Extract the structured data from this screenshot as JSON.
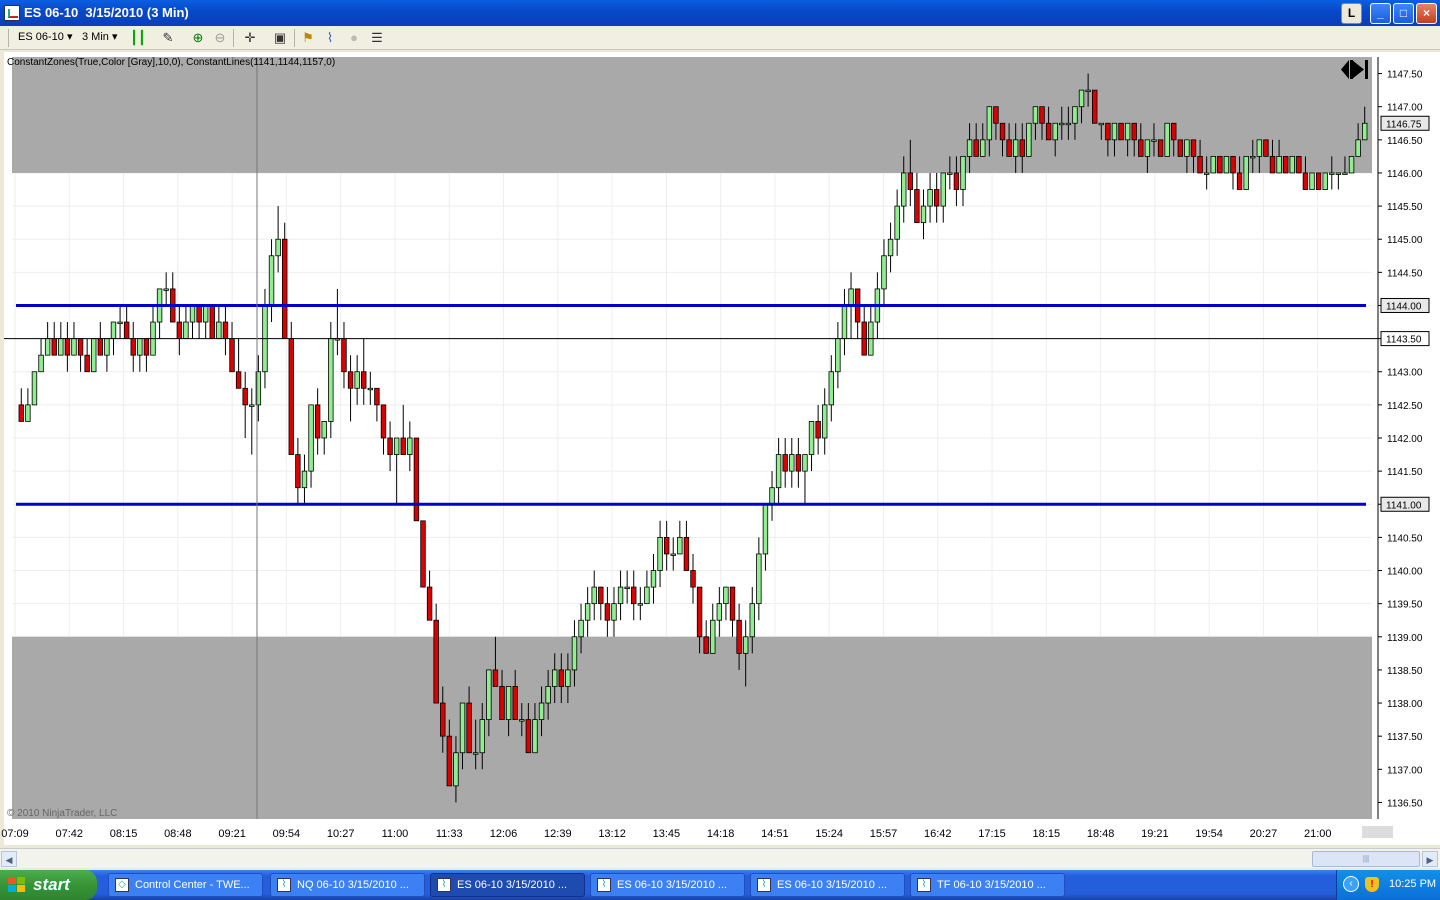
{
  "window": {
    "title": "ES 06-10  3/15/2010 (3 Min)",
    "buttons": {
      "restore_small": "L",
      "minimize": "_",
      "maximize": "□",
      "close": "×"
    }
  },
  "toolbar": {
    "instrument": "ES 06-10",
    "interval": "3 Min",
    "icons": [
      "bar-style-icon",
      "drawing-tool-icon",
      "zoom-in-icon",
      "zoom-out-icon",
      "crosshair-icon",
      "properties-icon",
      "strategies-icon",
      "indicators-icon",
      "record-icon",
      "data-box-icon"
    ]
  },
  "chart": {
    "indicator_label": "ConstantZones(True,Color [Gray],10,0), ConstantLines(1141,1144,1157,0)",
    "copyright": "© 2010 NinjaTrader, LLC",
    "last_price_label": "1146.75",
    "crosshair_price_label": "1143.50",
    "jump_to_end_icon": "jump-to-end-icon"
  },
  "chart_data": {
    "type": "candlestick",
    "y_range": [
      1136.25,
      1147.75
    ],
    "y_ticks": [
      "1147.50",
      "1147.00",
      "1146.50",
      "1146.00",
      "1145.50",
      "1145.00",
      "1144.50",
      "1144.00",
      "1143.50",
      "1143.00",
      "1142.50",
      "1142.00",
      "1141.50",
      "1141.00",
      "1140.50",
      "1140.00",
      "1139.50",
      "1139.00",
      "1138.50",
      "1138.00",
      "1137.50",
      "1137.00",
      "1136.50"
    ],
    "y_tick_values": [
      1147.5,
      1147.0,
      1146.5,
      1146.0,
      1145.5,
      1145.0,
      1144.5,
      1144.0,
      1143.5,
      1143.0,
      1142.5,
      1142.0,
      1141.5,
      1141.0,
      1140.5,
      1140.0,
      1139.5,
      1139.0,
      1138.5,
      1138.0,
      1137.5,
      1137.0,
      1136.5
    ],
    "x_ticks": [
      "07:09",
      "07:42",
      "08:15",
      "08:48",
      "09:21",
      "09:54",
      "10:27",
      "11:00",
      "11:33",
      "12:06",
      "12:39",
      "13:12",
      "13:45",
      "14:18",
      "14:51",
      "15:24",
      "15:57",
      "16:42",
      "17:15",
      "18:15",
      "18:48",
      "19:21",
      "19:54",
      "20:27",
      "21:00"
    ],
    "zones": [
      {
        "from": 1146.0,
        "to": 1147.75,
        "color": "#a9a9a9"
      },
      {
        "from": 1136.25,
        "to": 1139.0,
        "color": "#a9a9a9"
      }
    ],
    "constant_lines": [
      1144.0,
      1141.0
    ],
    "line_color": "#0000cc",
    "up_color": "#90ee90",
    "down_color": "#dd0000",
    "bars": [
      [
        1142.5,
        1142.75,
        1142.25,
        1142.25
      ],
      [
        1142.25,
        1142.75,
        1142.25,
        1142.5
      ],
      [
        1142.5,
        1143.0,
        1142.5,
        1143.0
      ],
      [
        1143.0,
        1143.5,
        1143.0,
        1143.25
      ],
      [
        1143.25,
        1143.75,
        1143.25,
        1143.5
      ],
      [
        1143.5,
        1143.75,
        1143.25,
        1143.25
      ],
      [
        1143.25,
        1143.75,
        1143.25,
        1143.5
      ],
      [
        1143.5,
        1143.75,
        1143.0,
        1143.25
      ],
      [
        1143.25,
        1143.75,
        1143.25,
        1143.5
      ],
      [
        1143.5,
        1143.5,
        1143.0,
        1143.25
      ],
      [
        1143.25,
        1143.5,
        1143.0,
        1143.0
      ],
      [
        1143.0,
        1143.5,
        1143.0,
        1143.5
      ],
      [
        1143.5,
        1143.75,
        1143.25,
        1143.25
      ],
      [
        1143.25,
        1143.5,
        1143.0,
        1143.5
      ],
      [
        1143.5,
        1143.75,
        1143.25,
        1143.75
      ],
      [
        1143.75,
        1144.0,
        1143.5,
        1143.75
      ],
      [
        1143.75,
        1144.0,
        1143.5,
        1143.5
      ],
      [
        1143.5,
        1143.75,
        1143.0,
        1143.25
      ],
      [
        1143.25,
        1143.5,
        1143.0,
        1143.5
      ],
      [
        1143.5,
        1143.5,
        1143.0,
        1143.25
      ],
      [
        1143.25,
        1144.0,
        1143.25,
        1143.75
      ],
      [
        1143.75,
        1144.25,
        1143.5,
        1144.25
      ],
      [
        1144.25,
        1144.5,
        1144.0,
        1144.25
      ],
      [
        1144.25,
        1144.5,
        1143.75,
        1143.75
      ],
      [
        1143.75,
        1144.0,
        1143.25,
        1143.5
      ],
      [
        1143.5,
        1144.0,
        1143.5,
        1143.75
      ],
      [
        1143.75,
        1144.0,
        1143.5,
        1144.0
      ],
      [
        1144.0,
        1144.0,
        1143.5,
        1143.75
      ],
      [
        1143.75,
        1144.0,
        1143.5,
        1144.0
      ],
      [
        1144.0,
        1144.0,
        1143.5,
        1143.5
      ],
      [
        1143.5,
        1144.0,
        1143.5,
        1143.75
      ],
      [
        1143.75,
        1144.0,
        1143.25,
        1143.5
      ],
      [
        1143.5,
        1143.75,
        1143.0,
        1143.0
      ],
      [
        1143.0,
        1143.5,
        1142.75,
        1142.75
      ],
      [
        1142.75,
        1143.0,
        1142.0,
        1142.5
      ],
      [
        1142.5,
        1142.75,
        1141.75,
        1142.5
      ],
      [
        1142.5,
        1143.25,
        1142.25,
        1143.0
      ],
      [
        1143.0,
        1144.25,
        1142.75,
        1144.0
      ],
      [
        1144.0,
        1145.0,
        1143.75,
        1144.75
      ],
      [
        1144.75,
        1145.5,
        1144.5,
        1145.0
      ],
      [
        1145.0,
        1145.25,
        1143.5,
        1143.5
      ],
      [
        1143.5,
        1143.75,
        1141.75,
        1141.75
      ],
      [
        1141.75,
        1142.0,
        1141.0,
        1141.25
      ],
      [
        1141.25,
        1141.75,
        1141.0,
        1141.5
      ],
      [
        1141.5,
        1142.5,
        1141.25,
        1142.5
      ],
      [
        1142.5,
        1142.75,
        1141.75,
        1142.0
      ],
      [
        1142.0,
        1142.25,
        1141.75,
        1142.25
      ],
      [
        1142.25,
        1143.75,
        1142.0,
        1143.5
      ],
      [
        1143.5,
        1144.25,
        1143.25,
        1143.5
      ],
      [
        1143.5,
        1143.75,
        1142.75,
        1143.0
      ],
      [
        1143.0,
        1143.25,
        1142.25,
        1142.75
      ],
      [
        1142.75,
        1143.25,
        1142.5,
        1143.0
      ],
      [
        1143.0,
        1143.5,
        1142.5,
        1142.75
      ],
      [
        1142.75,
        1143.0,
        1142.5,
        1142.75
      ],
      [
        1142.75,
        1142.75,
        1142.25,
        1142.5
      ],
      [
        1142.5,
        1142.5,
        1141.75,
        1142.0
      ],
      [
        1142.0,
        1142.25,
        1141.5,
        1141.75
      ],
      [
        1141.75,
        1142.0,
        1141.0,
        1142.0
      ],
      [
        1142.0,
        1142.5,
        1141.75,
        1141.75
      ],
      [
        1141.75,
        1142.25,
        1141.5,
        1142.0
      ],
      [
        1142.0,
        1142.0,
        1141.0,
        1140.75
      ],
      [
        1140.75,
        1140.75,
        1139.75,
        1139.75
      ],
      [
        1139.75,
        1140.0,
        1139.25,
        1139.25
      ],
      [
        1139.25,
        1139.5,
        1138.5,
        1138.0
      ],
      [
        1138.0,
        1138.25,
        1137.25,
        1137.5
      ],
      [
        1137.5,
        1137.75,
        1136.75,
        1136.75
      ],
      [
        1136.75,
        1137.5,
        1136.5,
        1137.25
      ],
      [
        1137.25,
        1138.0,
        1137.0,
        1138.0
      ],
      [
        1138.0,
        1138.25,
        1137.25,
        1137.25
      ],
      [
        1137.25,
        1137.75,
        1137.0,
        1137.25
      ],
      [
        1137.25,
        1138.0,
        1137.0,
        1137.75
      ],
      [
        1137.75,
        1138.5,
        1137.5,
        1138.5
      ],
      [
        1138.5,
        1139.0,
        1138.25,
        1138.25
      ],
      [
        1138.25,
        1138.5,
        1137.75,
        1137.75
      ],
      [
        1137.75,
        1138.25,
        1137.5,
        1138.25
      ],
      [
        1138.25,
        1138.5,
        1137.75,
        1137.75
      ],
      [
        1137.75,
        1138.0,
        1137.5,
        1137.75
      ],
      [
        1137.75,
        1138.0,
        1137.25,
        1137.25
      ],
      [
        1137.25,
        1138.0,
        1137.25,
        1137.75
      ],
      [
        1137.75,
        1138.25,
        1137.5,
        1138.0
      ],
      [
        1138.0,
        1138.5,
        1137.75,
        1138.25
      ],
      [
        1138.25,
        1138.75,
        1138.0,
        1138.5
      ],
      [
        1138.5,
        1138.75,
        1138.0,
        1138.25
      ],
      [
        1138.25,
        1138.75,
        1138.0,
        1138.5
      ],
      [
        1138.5,
        1139.25,
        1138.25,
        1139.0
      ],
      [
        1139.0,
        1139.5,
        1138.75,
        1139.25
      ],
      [
        1139.25,
        1139.75,
        1139.0,
        1139.5
      ],
      [
        1139.5,
        1140.0,
        1139.25,
        1139.75
      ],
      [
        1139.75,
        1139.75,
        1139.25,
        1139.5
      ],
      [
        1139.5,
        1139.75,
        1139.0,
        1139.25
      ],
      [
        1139.25,
        1139.75,
        1139.0,
        1139.5
      ],
      [
        1139.5,
        1140.0,
        1139.25,
        1139.75
      ],
      [
        1139.75,
        1140.0,
        1139.5,
        1139.75
      ],
      [
        1139.75,
        1140.0,
        1139.25,
        1139.5
      ],
      [
        1139.5,
        1139.75,
        1139.25,
        1139.5
      ],
      [
        1139.5,
        1140.0,
        1139.5,
        1139.75
      ],
      [
        1139.75,
        1140.25,
        1139.5,
        1140.0
      ],
      [
        1140.0,
        1140.75,
        1139.75,
        1140.5
      ],
      [
        1140.5,
        1140.75,
        1140.0,
        1140.25
      ],
      [
        1140.25,
        1140.5,
        1140.0,
        1140.25
      ],
      [
        1140.25,
        1140.75,
        1140.25,
        1140.5
      ],
      [
        1140.5,
        1140.75,
        1140.0,
        1140.0
      ],
      [
        1140.0,
        1140.25,
        1139.5,
        1139.75
      ],
      [
        1139.75,
        1139.75,
        1138.75,
        1139.0
      ],
      [
        1139.0,
        1139.25,
        1138.75,
        1138.75
      ],
      [
        1138.75,
        1139.5,
        1138.75,
        1139.25
      ],
      [
        1139.25,
        1139.75,
        1139.0,
        1139.5
      ],
      [
        1139.5,
        1139.75,
        1139.25,
        1139.75
      ],
      [
        1139.75,
        1139.75,
        1139.0,
        1139.25
      ],
      [
        1139.25,
        1139.5,
        1138.5,
        1138.75
      ],
      [
        1138.75,
        1139.25,
        1138.25,
        1139.0
      ],
      [
        1139.0,
        1139.75,
        1138.75,
        1139.5
      ],
      [
        1139.5,
        1140.5,
        1139.25,
        1140.25
      ],
      [
        1140.25,
        1141.0,
        1140.0,
        1141.0
      ],
      [
        1141.0,
        1141.5,
        1140.75,
        1141.25
      ],
      [
        1141.25,
        1142.0,
        1141.0,
        1141.75
      ],
      [
        1141.75,
        1142.0,
        1141.25,
        1141.5
      ],
      [
        1141.5,
        1142.0,
        1141.25,
        1141.75
      ],
      [
        1141.75,
        1142.0,
        1141.25,
        1141.5
      ],
      [
        1141.5,
        1141.75,
        1141.0,
        1141.75
      ],
      [
        1141.75,
        1142.25,
        1141.5,
        1142.25
      ],
      [
        1142.25,
        1142.5,
        1141.75,
        1142.0
      ],
      [
        1142.0,
        1142.75,
        1141.75,
        1142.5
      ],
      [
        1142.5,
        1143.25,
        1142.25,
        1143.0
      ],
      [
        1143.0,
        1143.75,
        1142.75,
        1143.5
      ],
      [
        1143.5,
        1144.25,
        1143.25,
        1144.0
      ],
      [
        1144.0,
        1144.5,
        1143.5,
        1144.25
      ],
      [
        1144.25,
        1144.25,
        1143.5,
        1143.75
      ],
      [
        1143.75,
        1144.0,
        1143.25,
        1143.25
      ],
      [
        1143.25,
        1144.0,
        1143.25,
        1143.75
      ],
      [
        1143.75,
        1144.5,
        1143.5,
        1144.25
      ],
      [
        1144.25,
        1145.0,
        1144.0,
        1144.75
      ],
      [
        1144.75,
        1145.25,
        1144.5,
        1145.0
      ],
      [
        1145.0,
        1145.75,
        1144.75,
        1145.5
      ],
      [
        1145.5,
        1146.25,
        1145.25,
        1146.0
      ],
      [
        1146.0,
        1146.5,
        1145.5,
        1145.75
      ],
      [
        1145.75,
        1146.0,
        1145.25,
        1145.25
      ],
      [
        1145.25,
        1145.75,
        1145.0,
        1145.5
      ],
      [
        1145.5,
        1146.0,
        1145.25,
        1145.75
      ],
      [
        1145.75,
        1146.0,
        1145.25,
        1145.5
      ],
      [
        1145.5,
        1146.0,
        1145.25,
        1146.0
      ],
      [
        1146.0,
        1146.25,
        1145.75,
        1146.0
      ],
      [
        1146.0,
        1146.25,
        1145.5,
        1145.75
      ],
      [
        1145.75,
        1146.25,
        1145.5,
        1146.25
      ],
      [
        1146.25,
        1146.75,
        1146.0,
        1146.5
      ],
      [
        1146.5,
        1146.75,
        1146.25,
        1146.25
      ],
      [
        1146.25,
        1146.75,
        1146.25,
        1146.5
      ],
      [
        1146.5,
        1147.0,
        1146.25,
        1147.0
      ],
      [
        1147.0,
        1147.0,
        1146.5,
        1146.75
      ],
      [
        1146.75,
        1146.75,
        1146.25,
        1146.5
      ],
      [
        1146.5,
        1146.75,
        1146.25,
        1146.25
      ],
      [
        1146.25,
        1146.75,
        1146.0,
        1146.5
      ],
      [
        1146.5,
        1146.75,
        1146.0,
        1146.25
      ],
      [
        1146.25,
        1146.75,
        1146.25,
        1146.75
      ],
      [
        1146.75,
        1147.0,
        1146.5,
        1147.0
      ],
      [
        1147.0,
        1147.0,
        1146.5,
        1146.75
      ],
      [
        1146.75,
        1147.0,
        1146.5,
        1146.5
      ],
      [
        1146.5,
        1146.75,
        1146.25,
        1146.75
      ],
      [
        1146.75,
        1147.0,
        1146.5,
        1146.75
      ],
      [
        1146.75,
        1147.0,
        1146.5,
        1146.75
      ],
      [
        1146.75,
        1147.0,
        1146.5,
        1147.0
      ],
      [
        1147.0,
        1147.25,
        1146.75,
        1147.25
      ],
      [
        1147.25,
        1147.5,
        1147.0,
        1147.25
      ],
      [
        1147.25,
        1147.25,
        1146.75,
        1146.75
      ],
      [
        1146.75,
        1146.75,
        1146.5,
        1146.75
      ],
      [
        1146.75,
        1146.75,
        1146.25,
        1146.5
      ],
      [
        1146.5,
        1146.75,
        1146.25,
        1146.75
      ],
      [
        1146.75,
        1146.75,
        1146.5,
        1146.5
      ],
      [
        1146.5,
        1146.75,
        1146.25,
        1146.75
      ],
      [
        1146.75,
        1146.75,
        1146.25,
        1146.5
      ],
      [
        1146.5,
        1146.75,
        1146.25,
        1146.25
      ],
      [
        1146.25,
        1146.5,
        1146.0,
        1146.5
      ],
      [
        1146.5,
        1146.75,
        1146.25,
        1146.5
      ],
      [
        1146.5,
        1146.5,
        1146.25,
        1146.25
      ],
      [
        1146.25,
        1146.75,
        1146.25,
        1146.75
      ],
      [
        1146.75,
        1146.75,
        1146.25,
        1146.5
      ],
      [
        1146.5,
        1146.5,
        1146.25,
        1146.25
      ],
      [
        1146.25,
        1146.5,
        1146.0,
        1146.5
      ],
      [
        1146.5,
        1146.5,
        1146.0,
        1146.25
      ],
      [
        1146.25,
        1146.5,
        1146.0,
        1146.0
      ],
      [
        1146.0,
        1146.25,
        1145.75,
        1146.0
      ],
      [
        1146.0,
        1146.25,
        1146.0,
        1146.25
      ],
      [
        1146.25,
        1146.25,
        1146.0,
        1146.0
      ],
      [
        1146.0,
        1146.25,
        1146.0,
        1146.25
      ],
      [
        1146.25,
        1146.25,
        1145.75,
        1146.0
      ],
      [
        1146.0,
        1146.25,
        1145.75,
        1145.75
      ],
      [
        1145.75,
        1146.25,
        1145.75,
        1146.25
      ],
      [
        1146.25,
        1146.5,
        1146.0,
        1146.25
      ],
      [
        1146.25,
        1146.5,
        1146.0,
        1146.5
      ],
      [
        1146.5,
        1146.5,
        1146.25,
        1146.25
      ],
      [
        1146.25,
        1146.5,
        1146.0,
        1146.0
      ],
      [
        1146.0,
        1146.5,
        1146.0,
        1146.25
      ],
      [
        1146.25,
        1146.25,
        1146.0,
        1146.0
      ],
      [
        1146.0,
        1146.25,
        1146.0,
        1146.25
      ],
      [
        1146.25,
        1146.25,
        1146.0,
        1146.0
      ],
      [
        1146.0,
        1146.25,
        1145.75,
        1145.75
      ],
      [
        1145.75,
        1146.0,
        1145.75,
        1146.0
      ],
      [
        1146.0,
        1146.0,
        1145.75,
        1145.75
      ],
      [
        1145.75,
        1146.0,
        1145.75,
        1146.0
      ],
      [
        1146.0,
        1146.25,
        1145.75,
        1146.0
      ],
      [
        1146.0,
        1146.0,
        1145.75,
        1146.0
      ],
      [
        1146.0,
        1146.25,
        1146.0,
        1146.0
      ],
      [
        1146.0,
        1146.25,
        1146.0,
        1146.25
      ],
      [
        1146.25,
        1146.75,
        1146.25,
        1146.5
      ],
      [
        1146.5,
        1147.0,
        1146.5,
        1146.75
      ]
    ]
  },
  "taskbar": {
    "start_label": "start",
    "tasks": [
      {
        "label": "Control Center - TWE...",
        "icon": "control-center-icon"
      },
      {
        "label": "NQ 06-10  3/15/2010 ...",
        "icon": "chart-icon"
      },
      {
        "label": "ES 06-10  3/15/2010 ...",
        "icon": "chart-icon",
        "active": true
      },
      {
        "label": "ES 06-10  3/15/2010 ...",
        "icon": "chart-icon"
      },
      {
        "label": "ES 06-10  3/15/2010 ...",
        "icon": "chart-icon"
      },
      {
        "label": "TF 06-10  3/15/2010 ...",
        "icon": "chart-icon"
      }
    ],
    "clock": "10:25 PM"
  }
}
